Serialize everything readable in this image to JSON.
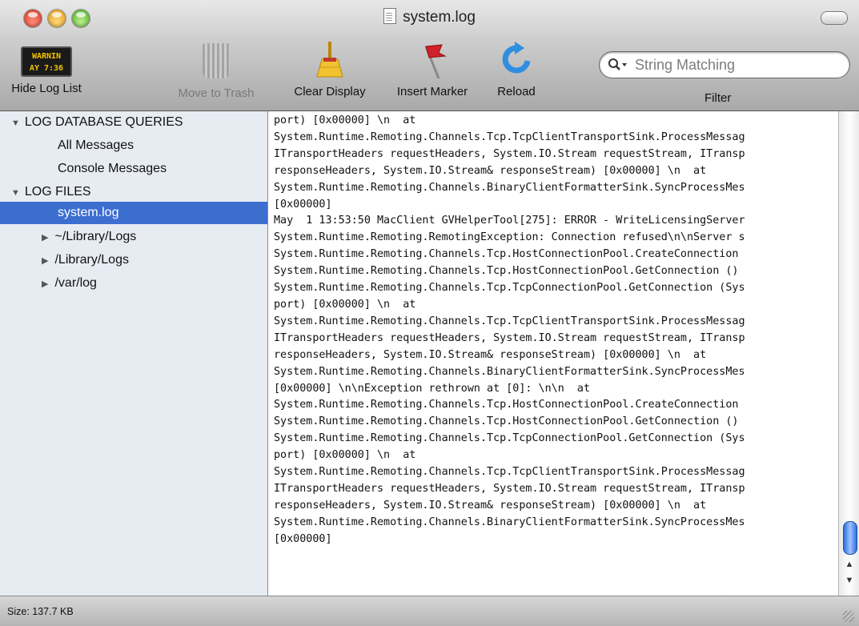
{
  "window": {
    "title": "system.log"
  },
  "toolbar": {
    "hide_log_list": "Hide Log List",
    "warning_badge_line1": "WARNIN",
    "warning_badge_line2": "AY 7:36",
    "move_to_trash": "Move to Trash",
    "clear_display": "Clear Display",
    "insert_marker": "Insert Marker",
    "reload": "Reload",
    "search_placeholder": "String Matching",
    "filter_label": "Filter"
  },
  "sidebar": {
    "items": [
      {
        "label": "LOG DATABASE QUERIES",
        "kind": "group-expanded"
      },
      {
        "label": "All Messages",
        "kind": "item"
      },
      {
        "label": "Console Messages",
        "kind": "item"
      },
      {
        "label": "LOG FILES",
        "kind": "group-expanded"
      },
      {
        "label": "system.log",
        "kind": "item",
        "selected": true
      },
      {
        "label": "~/Library/Logs",
        "kind": "folder-collapsed"
      },
      {
        "label": "/Library/Logs",
        "kind": "folder-collapsed"
      },
      {
        "label": "/var/log",
        "kind": "folder-collapsed"
      }
    ]
  },
  "log": {
    "lines": [
      "port) [0x00000] \\n  at",
      "System.Runtime.Remoting.Channels.Tcp.TcpClientTransportSink.ProcessMessag",
      "ITransportHeaders requestHeaders, System.IO.Stream requestStream, ITransp",
      "responseHeaders, System.IO.Stream& responseStream) [0x00000] \\n  at",
      "System.Runtime.Remoting.Channels.BinaryClientFormatterSink.SyncProcessMes",
      "[0x00000]",
      "May  1 13:53:50 MacClient GVHelperTool[275]: ERROR - WriteLicensingServer",
      "System.Runtime.Remoting.RemotingException: Connection refused\\n\\nServer s",
      "System.Runtime.Remoting.Channels.Tcp.HostConnectionPool.CreateConnection",
      "System.Runtime.Remoting.Channels.Tcp.HostConnectionPool.GetConnection ()",
      "System.Runtime.Remoting.Channels.Tcp.TcpConnectionPool.GetConnection (Sys",
      "port) [0x00000] \\n  at",
      "System.Runtime.Remoting.Channels.Tcp.TcpClientTransportSink.ProcessMessag",
      "ITransportHeaders requestHeaders, System.IO.Stream requestStream, ITransp",
      "responseHeaders, System.IO.Stream& responseStream) [0x00000] \\n  at",
      "System.Runtime.Remoting.Channels.BinaryClientFormatterSink.SyncProcessMes",
      "[0x00000] \\n\\nException rethrown at [0]: \\n\\n  at",
      "System.Runtime.Remoting.Channels.Tcp.HostConnectionPool.CreateConnection",
      "System.Runtime.Remoting.Channels.Tcp.HostConnectionPool.GetConnection ()",
      "System.Runtime.Remoting.Channels.Tcp.TcpConnectionPool.GetConnection (Sys",
      "port) [0x00000] \\n  at",
      "System.Runtime.Remoting.Channels.Tcp.TcpClientTransportSink.ProcessMessag",
      "ITransportHeaders requestHeaders, System.IO.Stream requestStream, ITransp",
      "responseHeaders, System.IO.Stream& responseStream) [0x00000] \\n  at",
      "System.Runtime.Remoting.Channels.BinaryClientFormatterSink.SyncProcessMes",
      "[0x00000]"
    ]
  },
  "status": {
    "size": "Size: 137.7 KB"
  },
  "colors": {
    "selection": "#3c6ed0",
    "sidebar_bg": "#e7ecf3",
    "scroll_thumb": "#2f6fdc"
  },
  "icons": [
    "warning-log-icon",
    "trash-icon",
    "broom-icon",
    "marker-flag-icon",
    "reload-icon",
    "search-icon",
    "document-icon"
  ]
}
